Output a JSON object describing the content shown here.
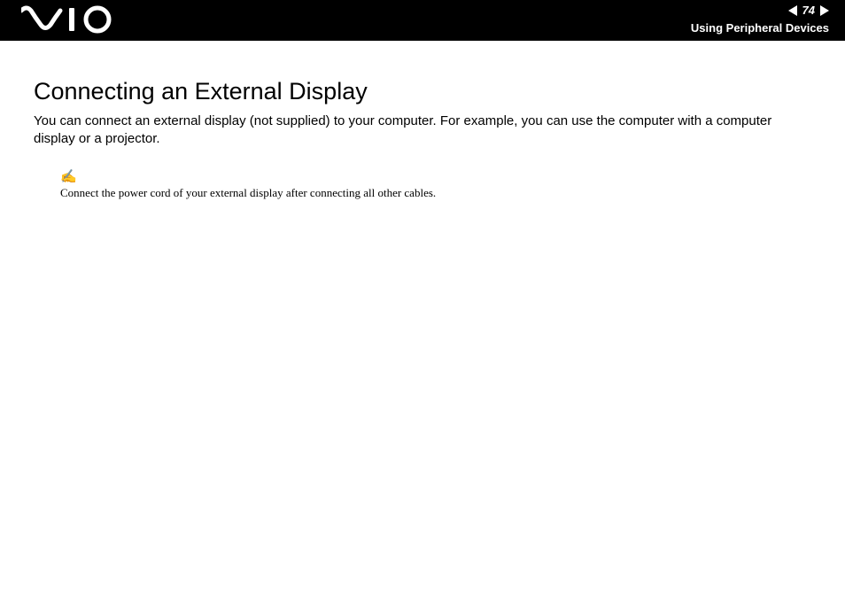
{
  "header": {
    "logo_label": "VAIO",
    "page_number": "74",
    "section": "Using Peripheral Devices"
  },
  "main": {
    "title": "Connecting an External Display",
    "body": "You can connect an external display (not supplied) to your computer. For example, you can use the computer with a computer display or a projector.",
    "note_icon": "✍",
    "note_text": "Connect the power cord of your external display after connecting all other cables."
  }
}
